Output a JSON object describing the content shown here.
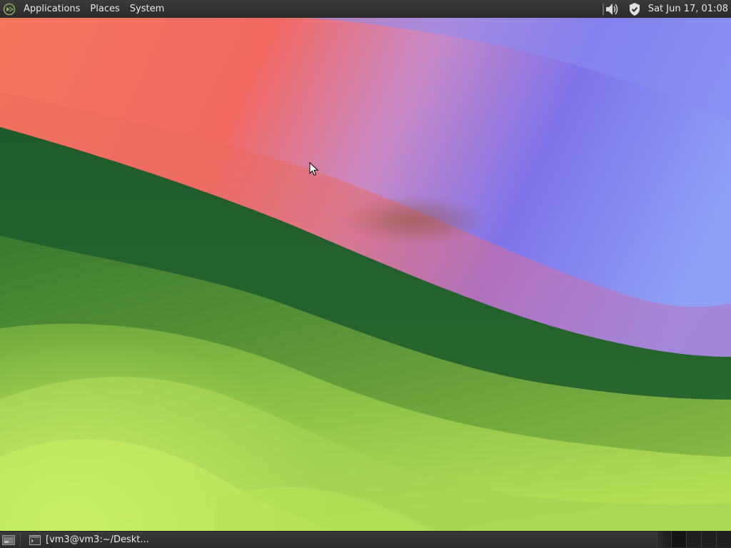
{
  "top_panel": {
    "menu_icon": "mate-menu-icon",
    "menus": [
      {
        "label": "Applications"
      },
      {
        "label": "Places"
      },
      {
        "label": "System"
      }
    ],
    "tray": {
      "volume_icon": "speaker-volume-icon",
      "security_icon": "shield-check-icon"
    },
    "clock": "Sat Jun 17, 01:08"
  },
  "bottom_panel": {
    "show_desktop_icon": "show-desktop-icon",
    "tasks": [
      {
        "label": "[vm3@vm3:~/Deskt...",
        "icon": "terminal-icon"
      }
    ],
    "workspaces": 4
  },
  "colors": {
    "panel_bg": "#2b2b2b",
    "panel_text": "#e8e8e8",
    "wallpaper_green_dark": "#1f5e2f",
    "wallpaper_green_light": "#b5e05a",
    "wallpaper_red": "#f06a5e",
    "wallpaper_blue": "#7f80f0"
  }
}
